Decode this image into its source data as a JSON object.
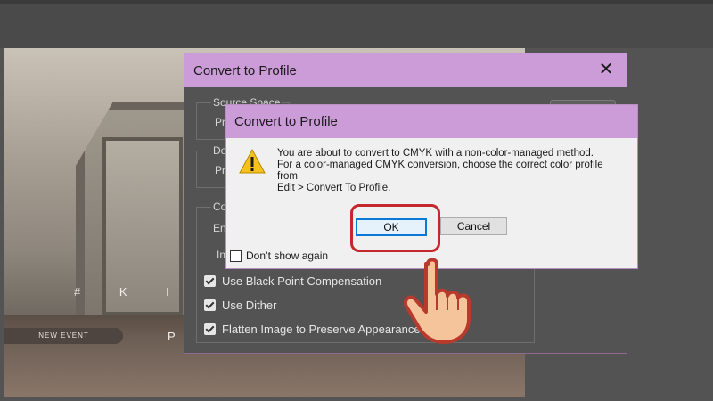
{
  "background_window": {
    "title": "Convert to Profile",
    "close_glyph": "✕",
    "groups": {
      "source_space": "Source Space",
      "source_sub": "Pr",
      "destination": "De",
      "destination_sub": "Pr",
      "conversion": "Co",
      "engine_sub": "En",
      "intent_sub": "In"
    },
    "options": [
      {
        "label": "Use Black Point Compensation",
        "checked": true
      },
      {
        "label": "Use Dither",
        "checked": true
      },
      {
        "label": "Flatten Image to Preserve Appearance",
        "checked": true
      }
    ]
  },
  "alert_dialog": {
    "title": "Convert to Profile",
    "icon": "warning-icon",
    "message_lines": [
      "You are about to convert to CMYK with a non-color-managed method.",
      "For a color-managed CMYK conversion, choose the correct color profile",
      "from",
      "Edit > Convert To Profile."
    ],
    "ok_label": "OK",
    "cancel_label": "Cancel",
    "dont_show_label": "Don’t show again",
    "dont_show_checked": false
  },
  "canvas_image": {
    "overlay_text": "# K I M T",
    "event_label": "NEW EVENT",
    "trailing_letter": "P"
  },
  "colors": {
    "titlebar": "#cb9cd8",
    "highlight": "#c4282c",
    "ok_border": "#0a78d7"
  }
}
